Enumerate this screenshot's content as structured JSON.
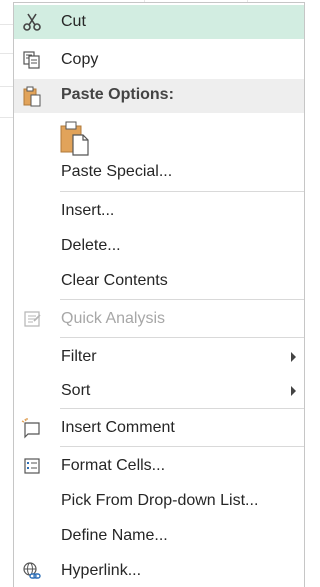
{
  "menu": {
    "cut": "Cut",
    "copy": "Copy",
    "paste_options": "Paste Options:",
    "paste_special": "Paste Special...",
    "insert": "Insert...",
    "delete": "Delete...",
    "clear_contents": "Clear Contents",
    "quick_analysis": "Quick Analysis",
    "filter": "Filter",
    "sort": "Sort",
    "insert_comment": "Insert Comment",
    "format_cells": "Format Cells...",
    "pick_from_list": "Pick From Drop-down List...",
    "define_name": "Define Name...",
    "hyperlink": "Hyperlink..."
  },
  "icons": {
    "cut": "scissors-icon",
    "copy": "copy-icon",
    "paste": "clipboard-icon",
    "quick_analysis": "quick-analysis-icon",
    "comment": "comment-icon",
    "format_cells": "format-cells-icon",
    "hyperlink": "hyperlink-icon"
  },
  "colors": {
    "hover": "#d2ede1",
    "header_bg": "#eeeeee",
    "disabled_text": "#a7a7a7",
    "clipboard": "#e1a35a"
  }
}
